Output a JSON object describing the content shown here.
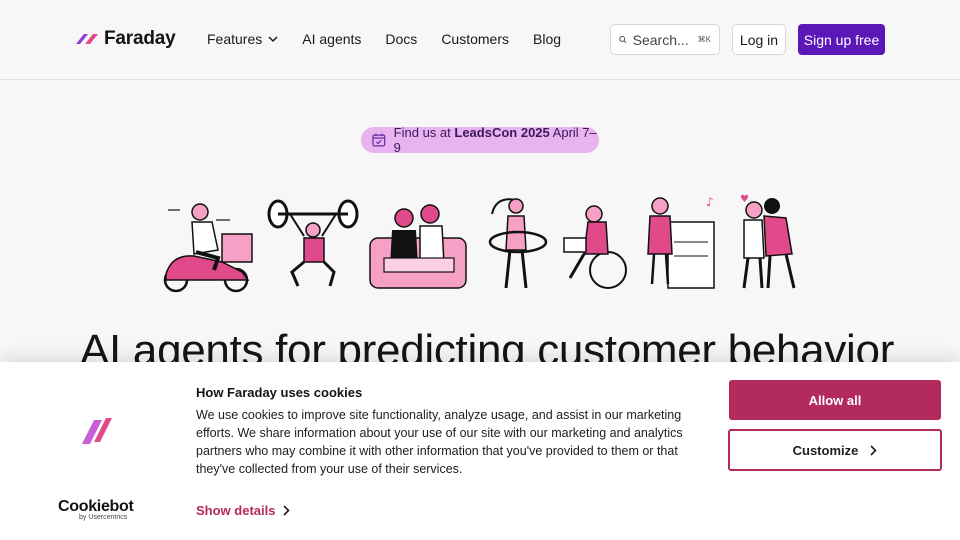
{
  "brand": {
    "name": "Faraday"
  },
  "nav": [
    {
      "label": "Features"
    },
    {
      "label": "AI agents"
    },
    {
      "label": "Docs"
    },
    {
      "label": "Customers"
    },
    {
      "label": "Blog"
    }
  ],
  "search": {
    "placeholder": "Search...",
    "shortcut": "⌘K"
  },
  "header": {
    "login_label": "Log in",
    "signup_label": "Sign up free"
  },
  "hero": {
    "badge_prefix": "Find us at",
    "badge_event": "LeadsCon 2025",
    "badge_date": "April 7–9",
    "title": "AI agents for predicting customer behavior"
  },
  "cookie": {
    "title": "How Faraday uses cookies",
    "body": "We use cookies to improve site functionality, analyze usage, and assist in our marketing efforts. We share information about your use of our site with our marketing and analytics partners who may combine it with other information that you've provided to them or that they've collected from your use of their services.",
    "show_details_label": "Show details",
    "allow_all_label": "Allow all",
    "customize_label": "Customize",
    "provider": "Cookiebot",
    "provider_sub": "by Usercentrics"
  },
  "colors": {
    "brand_purple": "#5b17b7",
    "accent_pink": "#e0498a",
    "cookie_accent": "#b22a5e",
    "badge_bg": "#e9b3f0"
  }
}
